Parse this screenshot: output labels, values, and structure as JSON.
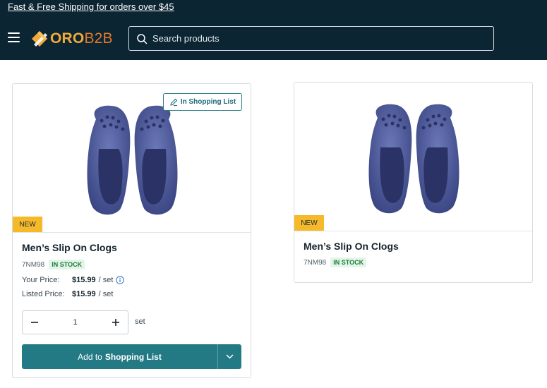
{
  "header": {
    "promo_text": "Fast & Free Shipping for orders over $45",
    "logo": {
      "part1": "ORO",
      "part2": "B2B",
      "mark_color": "#f2a93b"
    },
    "search": {
      "placeholder": "Search products",
      "value": ""
    },
    "menu_icon": "hamburger-icon",
    "search_icon": "search-icon"
  },
  "colors": {
    "header_bg": "#0c2533",
    "accent": "#237a85",
    "badge_new": "#f5b92a",
    "in_stock_bg": "#e3f5e8",
    "in_stock_text": "#1c7c3a"
  },
  "products": [
    {
      "badge": "NEW",
      "shopping_list_label": "In Shopping List",
      "name": "Men’s Slip On Clogs",
      "sku": "7NM98",
      "stock": "IN STOCK",
      "your_price_label": "Your Price:",
      "your_price": "$15.99",
      "your_price_unit": "/ set",
      "listed_price_label": "Listed Price:",
      "listed_price": "$15.99",
      "listed_price_unit": "/ set",
      "quantity": "1",
      "quantity_unit": "set",
      "add_label_prefix": "Add to",
      "add_label_bold": "Shopping List"
    },
    {
      "badge": "NEW",
      "name": "Men’s Slip On Clogs",
      "sku": "7NM98",
      "stock": "IN STOCK"
    }
  ]
}
